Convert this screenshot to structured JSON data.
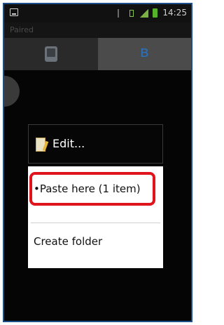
{
  "status_bar": {
    "time": "14:25"
  },
  "title_bar": {
    "text": "Paired"
  },
  "tabs": [
    {
      "name": "phone",
      "icon": "phone-icon"
    },
    {
      "name": "bluetooth",
      "icon": "bluetooth-icon"
    }
  ],
  "context_menu": {
    "edit_label": "Edit...",
    "paste_label": "•Paste here (1 item)",
    "create_folder_label": "Create folder"
  },
  "colors": {
    "frame_border": "#1c4f8a",
    "highlight": "#e0141c",
    "bluetooth": "#2a6fb8"
  }
}
